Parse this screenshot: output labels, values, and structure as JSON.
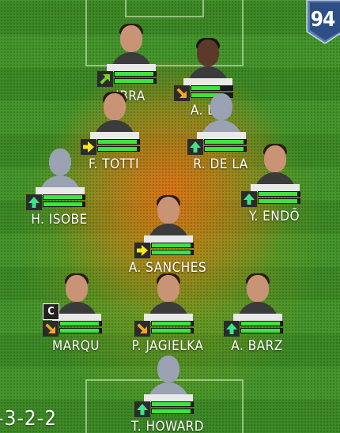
{
  "team_rating": "94",
  "formation": "-3-2-2",
  "players": [
    {
      "id": "ibra",
      "name": "IBRA",
      "photo": "face",
      "arrow": "up-right",
      "arrow_color": "#7ed321",
      "bar1": 0.95,
      "bar2": 0.95
    },
    {
      "id": "lo",
      "name": "A. LO",
      "photo": "face-dark",
      "arrow": "down-right",
      "arrow_color": "#f5a623",
      "bar1": 0.7,
      "bar2": 0.7
    },
    {
      "id": "totti",
      "name": "F. TOTTI",
      "photo": "face",
      "arrow": "right",
      "arrow_color": "#f8e71c",
      "bar1": 0.95,
      "bar2": 0.95
    },
    {
      "id": "dela",
      "name": "R. DE LA",
      "photo": "silhouette",
      "arrow": "up",
      "arrow_color": "#3ee38a",
      "bar1": 0.95,
      "bar2": 0.95
    },
    {
      "id": "isobe",
      "name": "H. ISOBE",
      "photo": "silhouette",
      "arrow": "up",
      "arrow_color": "#3ee38a",
      "bar1": 0.95,
      "bar2": 0.95
    },
    {
      "id": "endo",
      "name": "Y. ENDŌ",
      "photo": "face",
      "arrow": "up",
      "arrow_color": "#3ee38a",
      "bar1": 0.95,
      "bar2": 0.95
    },
    {
      "id": "sanches",
      "name": "A. SANCHES",
      "photo": "face",
      "arrow": "right",
      "arrow_color": "#f8e71c",
      "bar1": 0.95,
      "bar2": 0.95
    },
    {
      "id": "marqu",
      "name": "MARQU",
      "photo": "face",
      "arrow": "down-right",
      "arrow_color": "#f5a623",
      "bar1": 0.95,
      "bar2": 0.95,
      "captain": "C"
    },
    {
      "id": "jagielka",
      "name": "P. JAGIELKA",
      "photo": "face",
      "arrow": "down-right",
      "arrow_color": "#f5a623",
      "bar1": 0.95,
      "bar2": 0.95
    },
    {
      "id": "barz",
      "name": "A. BARZ",
      "photo": "face",
      "arrow": "up",
      "arrow_color": "#3ee38a",
      "bar1": 0.95,
      "bar2": 0.95
    },
    {
      "id": "howard",
      "name": "T. HOWARD",
      "photo": "silhouette",
      "arrow": "up",
      "arrow_color": "#3ee38a",
      "bar1": 0.95,
      "bar2": 0.95
    }
  ]
}
